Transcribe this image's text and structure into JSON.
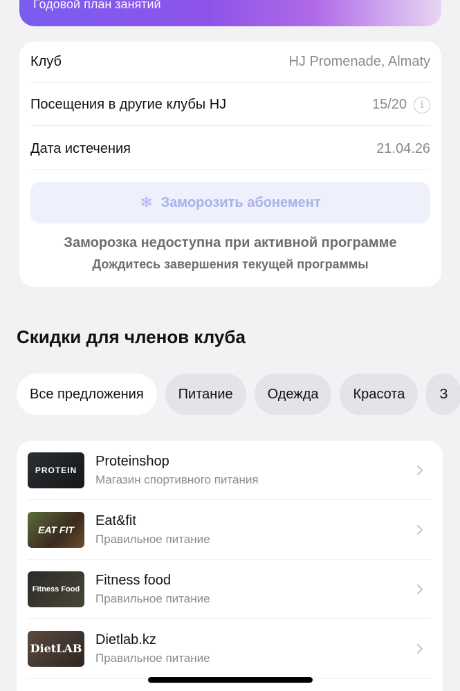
{
  "banner": {
    "text": "Годовой план занятий"
  },
  "membership": {
    "rows": [
      {
        "label": "Клуб",
        "value": "HJ Promenade, Almaty"
      },
      {
        "label": "Посещения в другие клубы HJ",
        "value": "15/20"
      },
      {
        "label": "Дата истечения",
        "value": "21.04.26"
      }
    ],
    "freeze_button": "Заморозить абонемент",
    "freeze_note": "Заморозка недоступна при активной программе",
    "freeze_sub": "Дождитесь завершения текущей программы"
  },
  "discounts": {
    "title": "Скидки для членов клуба",
    "chips": [
      "Все предложения",
      "Питание",
      "Одежда",
      "Красота",
      "З"
    ],
    "items": [
      {
        "name": "Proteinshop",
        "desc": "Магазин спортивного питания",
        "thumb_text": "PROTEIN"
      },
      {
        "name": "Eat&fit",
        "desc": "Правильное питание",
        "thumb_text": "EAT FIT"
      },
      {
        "name": "Fitness food",
        "desc": "Правильное питание",
        "thumb_text": "Fitness Food"
      },
      {
        "name": "Dietlab.kz",
        "desc": "Правильное питание",
        "thumb_text": "DietLAB"
      }
    ]
  },
  "icons": {
    "info": "info-icon",
    "snowflake": "snowflake-icon",
    "chevron": "chevron-right-icon"
  },
  "colors": {
    "accent_gradient_start": "#7b5cf0",
    "freeze_disabled": "#a9b1ea"
  }
}
